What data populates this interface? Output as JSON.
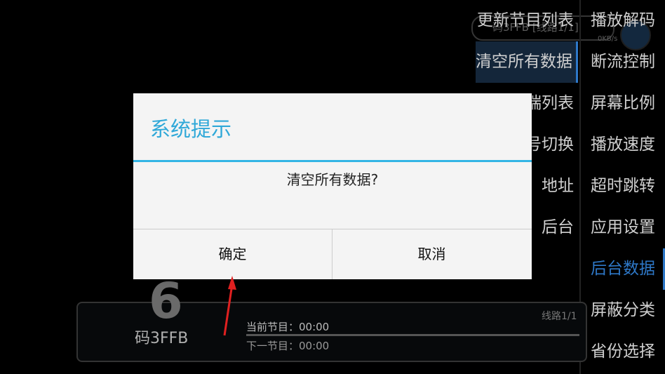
{
  "status": {
    "channel_text": "码3FFB  [线路1/1]",
    "speed": "0KB/s"
  },
  "menu_left": [
    {
      "label": "更新节目列表",
      "active": false
    },
    {
      "label": "清空所有数据",
      "active": true
    },
    {
      "label": "端列表",
      "active": false
    },
    {
      "label": "号切换",
      "active": false
    },
    {
      "label": "地址",
      "active": false
    },
    {
      "label": "后台",
      "active": false
    }
  ],
  "menu_right": [
    {
      "label": "播放解码",
      "active": false
    },
    {
      "label": "断流控制",
      "active": false
    },
    {
      "label": "屏幕比例",
      "active": false
    },
    {
      "label": "播放速度",
      "active": false
    },
    {
      "label": "超时跳转",
      "active": false
    },
    {
      "label": "应用设置",
      "active": false
    },
    {
      "label": "后台数据",
      "active": true
    },
    {
      "label": "屏蔽分类",
      "active": false
    },
    {
      "label": "省份选择",
      "active": false
    }
  ],
  "channel": {
    "number": "6",
    "name": "码3FFB",
    "now_program": "当前节目：00:00",
    "next_program": "下一节目：00:00",
    "line": "线路1/1"
  },
  "dialog": {
    "title": "系统提示",
    "message": "清空所有数据?",
    "ok_label": "确定",
    "cancel_label": "取消"
  },
  "colors": {
    "accent": "#33b5e5",
    "menu_active": "#2e78c8",
    "annotation": "#e02020"
  }
}
